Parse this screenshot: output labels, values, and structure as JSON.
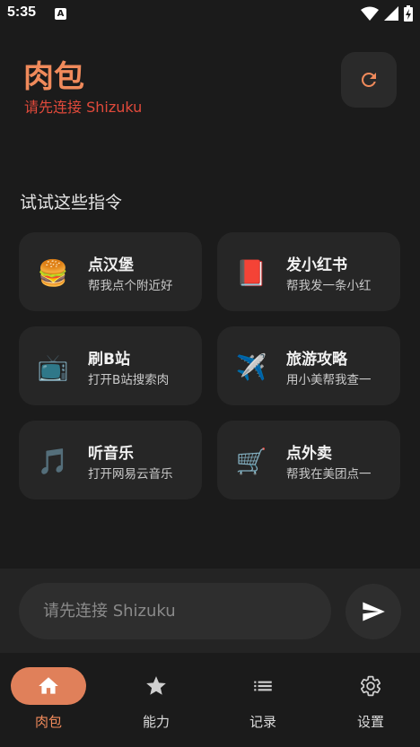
{
  "status_bar": {
    "time": "5:35",
    "notif_letter": "A"
  },
  "header": {
    "title": "肉包",
    "subtitle": "请先连接 Shizuku"
  },
  "section_title": "试试这些指令",
  "cards": [
    {
      "emoji": "🍔",
      "title": "点汉堡",
      "desc": "帮我点个附近好"
    },
    {
      "emoji": "📕",
      "title": "发小红书",
      "desc": "帮我发一条小红"
    },
    {
      "emoji": "📺",
      "title": "刷B站",
      "desc": "打开B站搜索肉"
    },
    {
      "emoji": "✈️",
      "title": "旅游攻略",
      "desc": "用小美帮我查一"
    },
    {
      "emoji": "🎵",
      "title": "听音乐",
      "desc": "打开网易云音乐"
    },
    {
      "emoji": "🛒",
      "title": "点外卖",
      "desc": "帮我在美团点一"
    }
  ],
  "input": {
    "placeholder": "请先连接 Shizuku"
  },
  "nav": [
    {
      "label": "肉包",
      "active": true
    },
    {
      "label": "能力"
    },
    {
      "label": "记录"
    },
    {
      "label": "设置"
    }
  ],
  "colors": {
    "accent": "#f08a5b",
    "error": "#e24a3b",
    "nav_active_bg": "#e0805a"
  }
}
